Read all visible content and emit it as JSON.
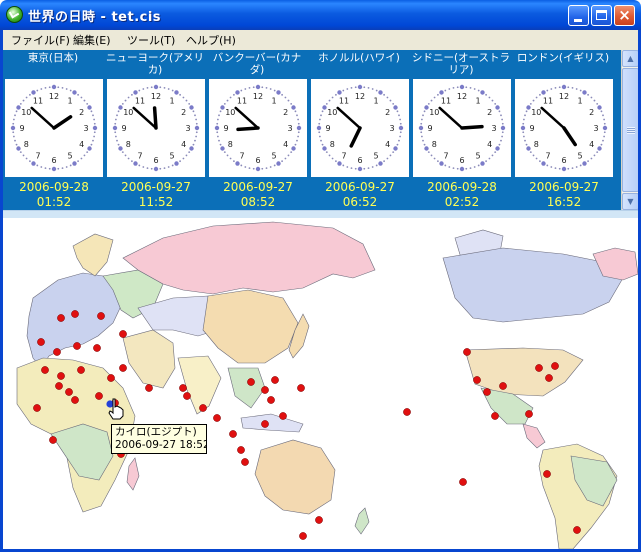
{
  "window": {
    "title": "世界の日時 - tet.cis",
    "buttons": {
      "minimize": "minimize",
      "maximize": "maximize",
      "close": "×"
    }
  },
  "menu": [
    {
      "label": "ファイル(F)"
    },
    {
      "label": "編集(E)"
    },
    {
      "label": "ツール(T)"
    },
    {
      "label": "ヘルプ(H)"
    }
  ],
  "clocks": [
    {
      "city": "東京(日本)",
      "date": "2006-09-28",
      "time": "01:52"
    },
    {
      "city": "ニューヨーク(アメリカ)",
      "date": "2006-09-27",
      "time": "11:52"
    },
    {
      "city": "バンクーバー(カナダ)",
      "date": "2006-09-27",
      "time": "08:52"
    },
    {
      "city": "ホノルル(ハワイ)",
      "date": "2006-09-27",
      "time": "06:52"
    },
    {
      "city": "シドニー(オーストラリア)",
      "date": "2006-09-28",
      "time": "02:52"
    },
    {
      "city": "ロンドン(イギリス)",
      "date": "2006-09-27",
      "time": "16:52"
    }
  ],
  "tooltip": {
    "city": "カイロ(エジプト)",
    "datetime": "2006-09-27 18:52"
  },
  "colors": {
    "panel": "#0b6fb8",
    "date_text": "#ffff55",
    "marker": "#e01010",
    "selected_marker": "#2340d8"
  }
}
